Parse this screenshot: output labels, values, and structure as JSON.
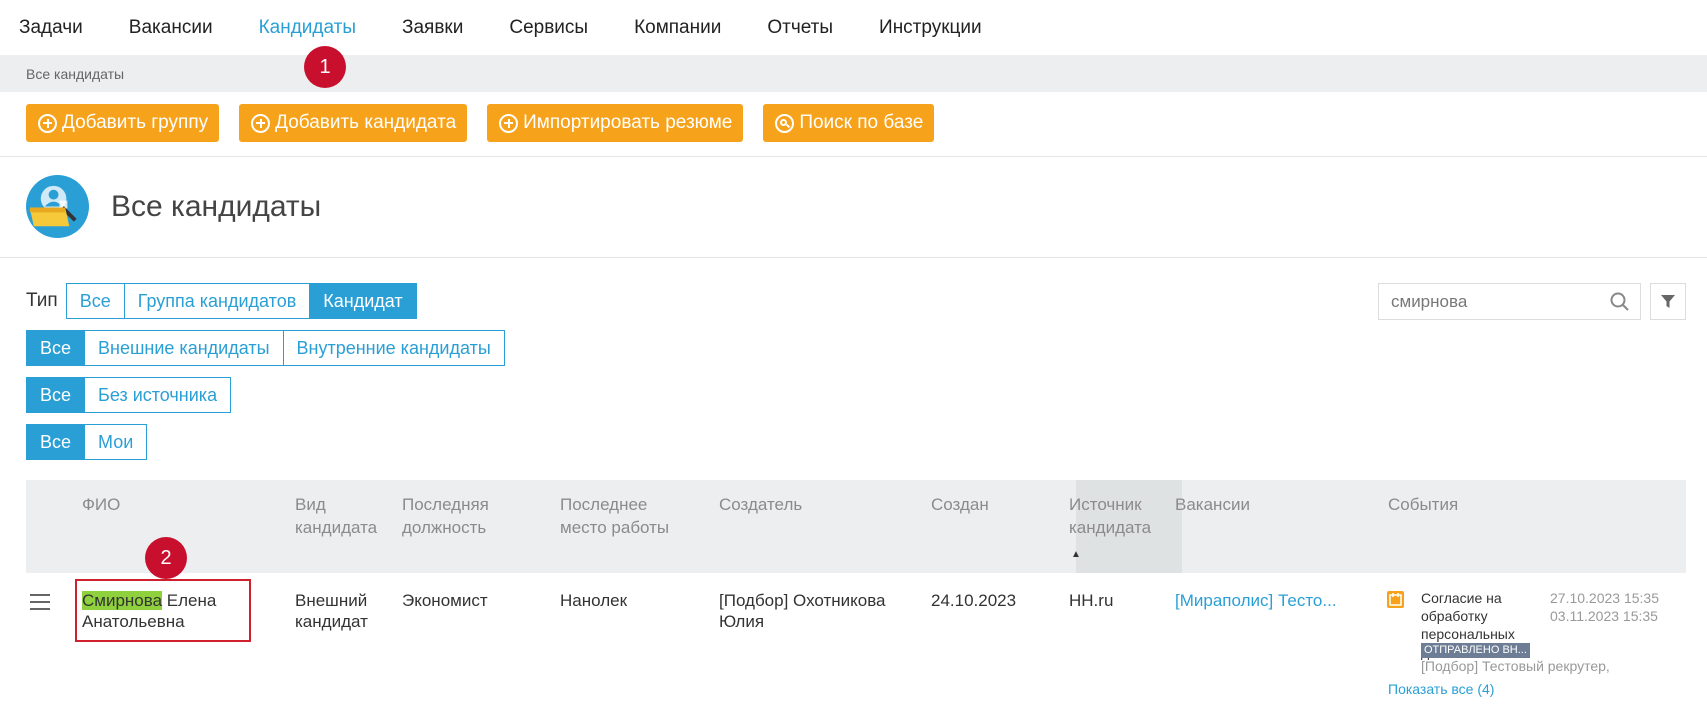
{
  "nav": {
    "items": [
      {
        "label": "Задачи"
      },
      {
        "label": "Вакансии"
      },
      {
        "label": "Кандидаты",
        "active": true
      },
      {
        "label": "Заявки"
      },
      {
        "label": "Сервисы"
      },
      {
        "label": "Компании"
      },
      {
        "label": "Отчеты"
      },
      {
        "label": "Инструкции"
      }
    ]
  },
  "breadcrumb": "Все кандидаты",
  "toolbar": {
    "add_group": "Добавить группу",
    "add_candidate": "Добавить кандидата",
    "import_resume": "Импортировать резюме",
    "search_db": "Поиск по базе"
  },
  "page": {
    "title": "Все кандидаты"
  },
  "filters": {
    "type_label": "Тип",
    "type": [
      "Все",
      "Группа кандидатов",
      "Кандидат"
    ],
    "kind": [
      "Все",
      "Внешние кандидаты",
      "Внутренние кандидаты"
    ],
    "source": [
      "Все",
      "Без источника"
    ],
    "owner": [
      "Все",
      "Мои"
    ]
  },
  "search": {
    "value": "смирнова"
  },
  "markers": [
    "1",
    "2"
  ],
  "table": {
    "columns": {
      "name": "ФИО",
      "kind": [
        "Вид",
        "кандидата"
      ],
      "position": [
        "Последняя",
        "должность"
      ],
      "workplace": [
        "Последнее",
        "место работы"
      ],
      "creator": "Создатель",
      "created": "Создан",
      "source": [
        "Источник",
        "кандидата"
      ],
      "vacancies": "Вакансии",
      "events": "События"
    },
    "row": {
      "name_highlight": "Смирнова",
      "name_rest": " Елена",
      "name_line2": "Анатольевна",
      "kind": [
        "Внешний",
        "кандидат"
      ],
      "position": "Экономист",
      "workplace": "Нанолек",
      "creator": [
        "[Подбор] Охотникова",
        "Юлия"
      ],
      "created": "24.10.2023",
      "source": "HH.ru",
      "vacancy": "[Мираполис] Тесто...",
      "event": {
        "text": [
          "Согласие на",
          "обработку",
          "персональных данных"
        ],
        "dates": [
          "27.10.2023 15:35",
          "03.11.2023 15:35"
        ],
        "badge": "ОТПРАВЛЕНО ВН...",
        "author": "[Подбор] Тестовый рекрутер,",
        "show_all": "Показать все (4)"
      }
    }
  },
  "colors": {
    "accent": "#2a9fd6",
    "button": "#f7a21b",
    "marker": "#c8102e",
    "highlight": "#8fd13c"
  }
}
